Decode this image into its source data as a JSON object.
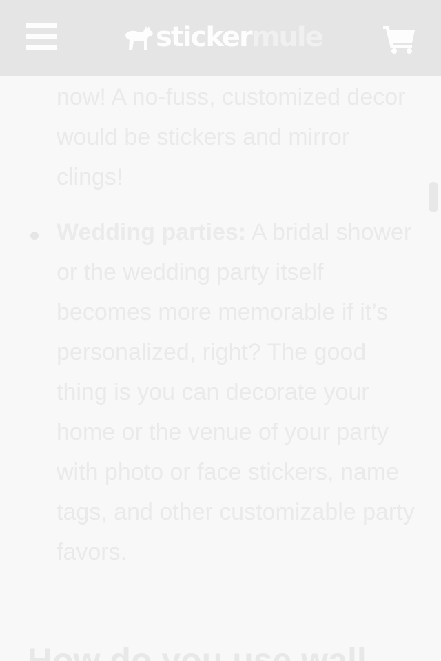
{
  "header": {
    "logo_part1": "sticker",
    "logo_part2": "mule"
  },
  "content": {
    "continued_text": "now! A no-fuss, customized decor would be stickers and mirror clings!",
    "bullet_label": "Wedding parties:",
    "bullet_text": " A bridal shower or the wedding party itself becomes more memorable if it’s personalized, right? The good thing is you can decorate your home or the venue of your party with photo or face stickers, name tags, and other customizable party favors.",
    "next_heading": "How do you use wall"
  }
}
